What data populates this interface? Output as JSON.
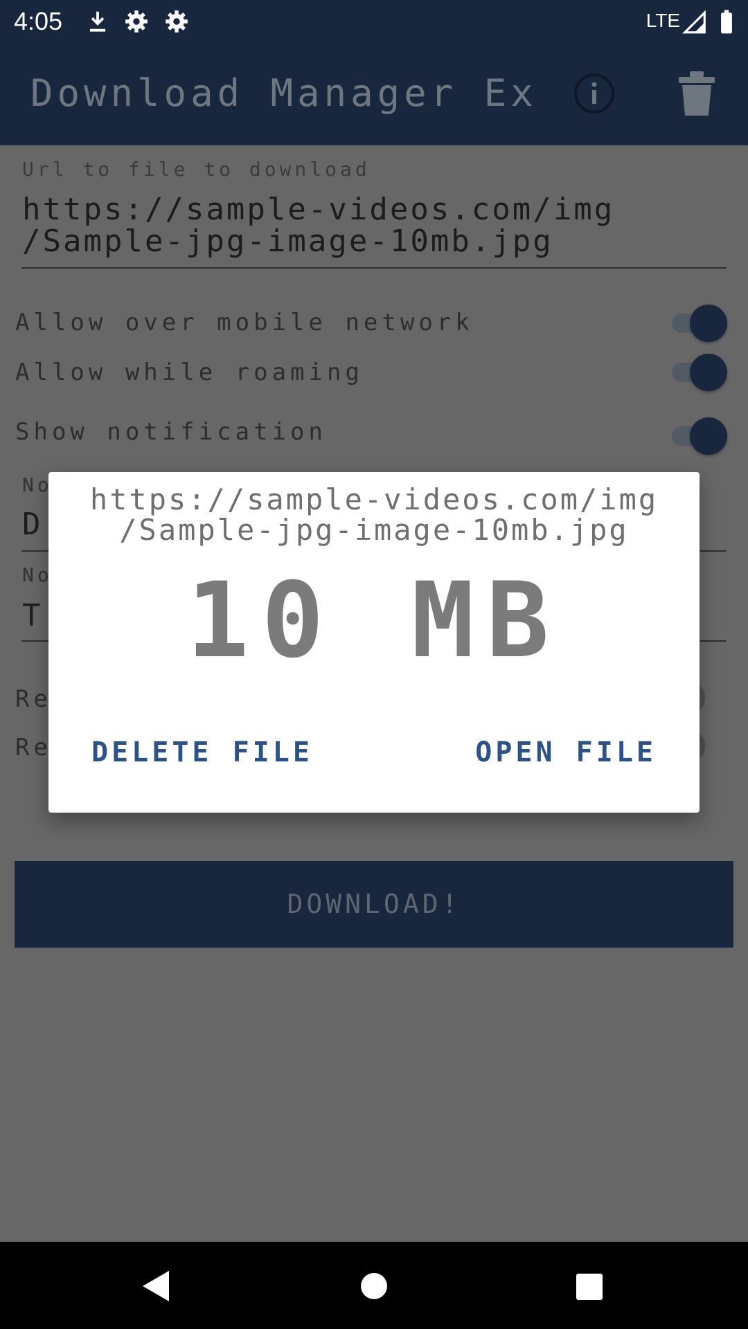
{
  "status_bar": {
    "time": "4:05",
    "network": "LTE",
    "icons": [
      "download-icon",
      "settings-icon",
      "settings-icon",
      "signal-icon",
      "battery-icon"
    ]
  },
  "app_bar": {
    "title": "Download Manager Ex",
    "info_icon": "info-icon",
    "trash_icon": "trash-icon"
  },
  "form": {
    "url_label": "Url to file to download",
    "url_value": "https://sample-videos.com/img\n/Sample-jpg-image-10mb.jpg",
    "allow_mobile": "Allow over mobile network",
    "allow_roaming": "Allow while roaming",
    "show_notification": "Show notification",
    "field1_label": "No",
    "field1_value": "D",
    "field2_label": "No",
    "field2_value": "T",
    "row1_label": "Re",
    "row2_label": "Re",
    "download_label": "DOWNLOAD!"
  },
  "dialog": {
    "url": "https://sample-videos.com/img\n/Sample-jpg-image-10mb.jpg",
    "size": "10 MB",
    "delete_label": "DELETE FILE",
    "open_label": "OPEN FILE"
  },
  "colors": {
    "primary": "#19273e",
    "accent_text": "#2e5187",
    "scrim": "#676767"
  }
}
